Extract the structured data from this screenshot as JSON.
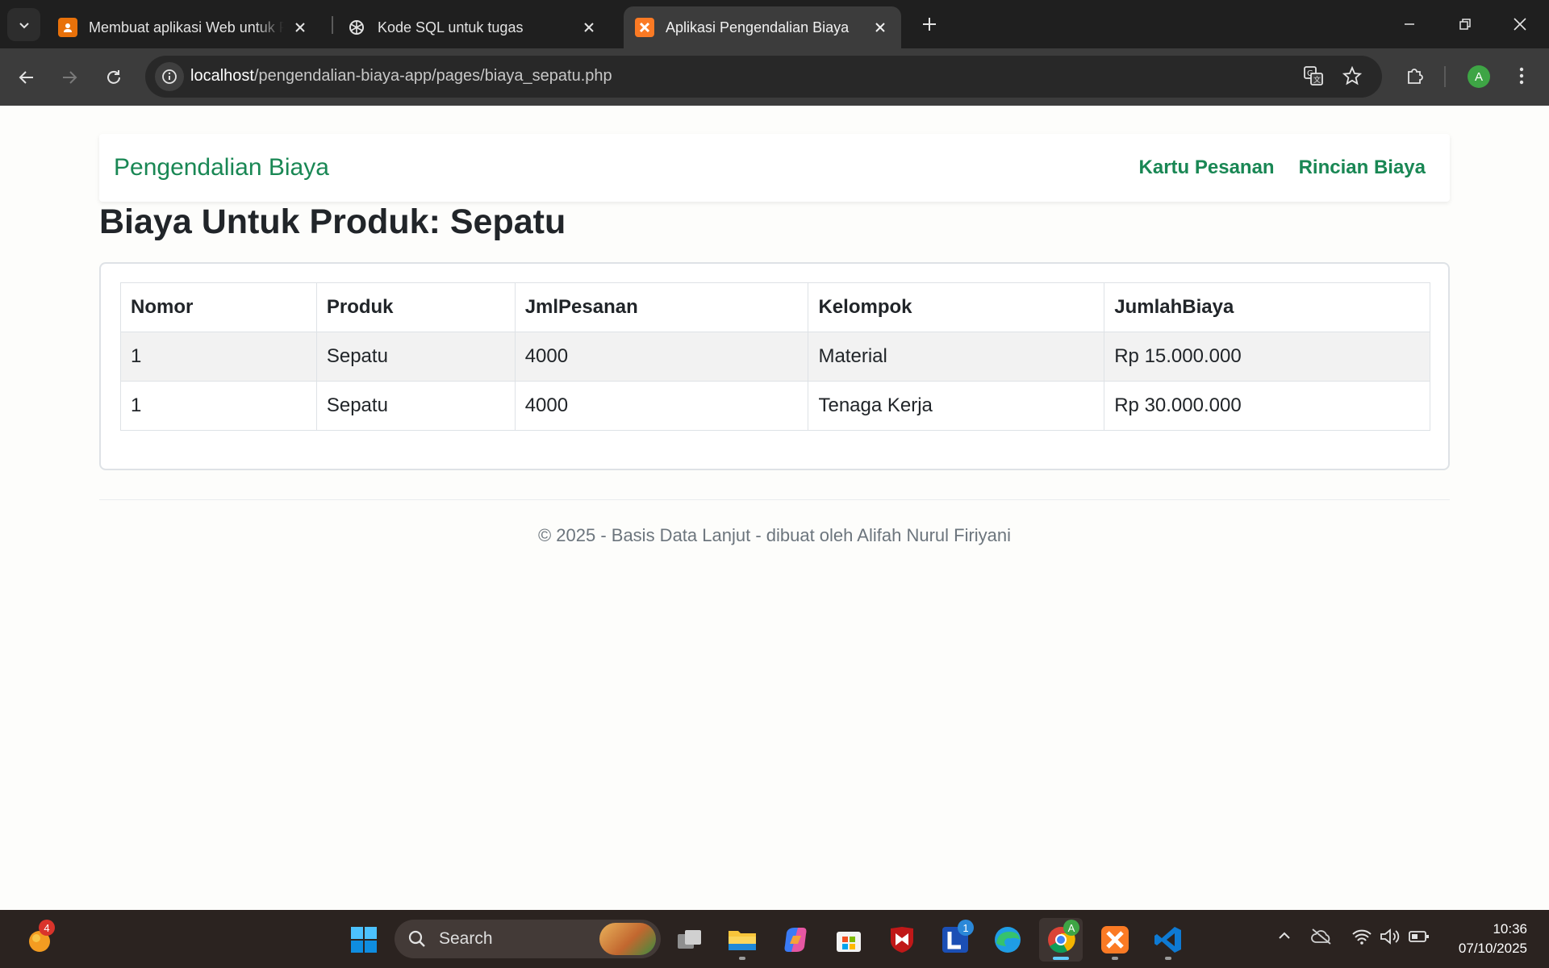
{
  "browser": {
    "tabs": [
      {
        "title": "Membuat aplikasi Web untuk Pengendalian Biaya",
        "active": false
      },
      {
        "title": "Kode SQL untuk tugas",
        "active": false
      },
      {
        "title": "Aplikasi Pengendalian Biaya",
        "active": true
      }
    ],
    "url_host": "localhost",
    "url_path": "/pengendalian-biaya-app/pages/biaya_sepatu.php",
    "profile_initial": "A"
  },
  "navbar": {
    "brand": "Pengendalian Biaya",
    "links": [
      "Kartu Pesanan",
      "Rincian Biaya"
    ]
  },
  "page_title": "Biaya Untuk Produk: Sepatu",
  "table": {
    "headers": [
      "Nomor",
      "Produk",
      "JmlPesanan",
      "Kelompok",
      "JumlahBiaya"
    ],
    "rows": [
      [
        "1",
        "Sepatu",
        "4000",
        "Material",
        "Rp 15.000.000"
      ],
      [
        "1",
        "Sepatu",
        "4000",
        "Tenaga Kerja",
        "Rp 30.000.000"
      ]
    ]
  },
  "footer": "© 2025 - Basis Data Lanjut - dibuat oleh Alifah Nurul Firiyani",
  "taskbar": {
    "search_label": "Search",
    "widget_badge": "4",
    "app_badge": "1",
    "profile_badge": "A",
    "time": "10:36",
    "date": "07/10/2025"
  },
  "colors": {
    "accent": "#198754",
    "chrome_bg": "#1f1f1f",
    "toolbar_bg": "#3c3c3c",
    "taskbar_bg": "#2b2320"
  }
}
